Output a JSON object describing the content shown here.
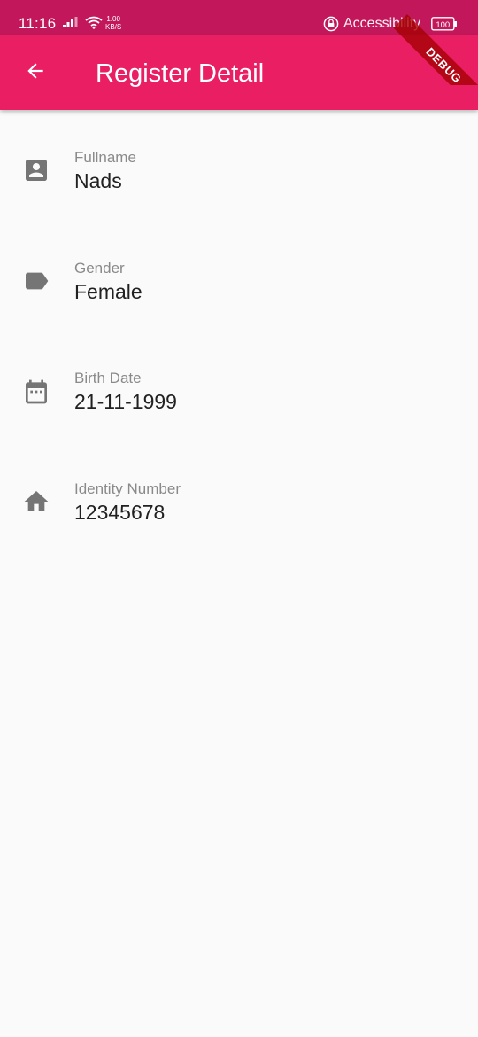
{
  "status_bar": {
    "time": "11:16",
    "speed_value": "1.00",
    "speed_unit": "KB/S",
    "accessibility_label": "Accessibility",
    "battery_level": "100",
    "background_color": "#c2185b"
  },
  "app_bar": {
    "title": "Register Detail",
    "back_icon": "arrow-back-icon",
    "background_color": "#e91e63"
  },
  "debug_banner": {
    "label": "DEBUG"
  },
  "details": [
    {
      "icon": "account-box-icon",
      "label": "Fullname",
      "value": "Nads"
    },
    {
      "icon": "label-tag-icon",
      "label": "Gender",
      "value": "Female"
    },
    {
      "icon": "calendar-icon",
      "label": "Birth Date",
      "value": "21-11-1999"
    },
    {
      "icon": "home-icon",
      "label": "Identity Number",
      "value": "12345678"
    }
  ],
  "colors": {
    "icon_grey": "#757575",
    "label_grey": "#8a8a8a",
    "value_text": "#212121",
    "page_background": "#fafafa"
  }
}
